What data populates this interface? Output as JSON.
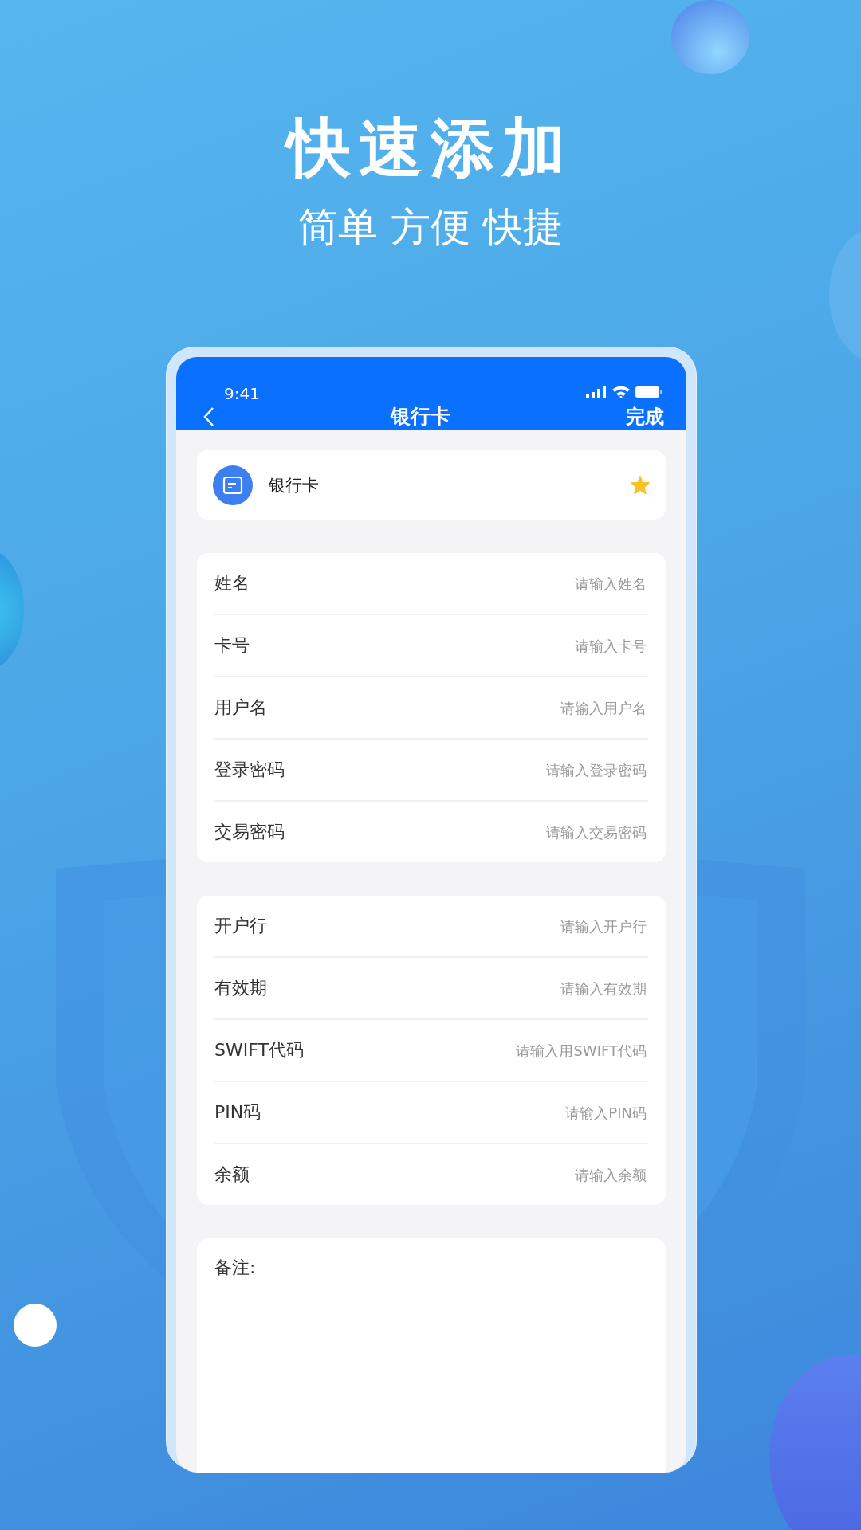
{
  "hero": {
    "title": "快速添加",
    "subtitle": "简单 方便 快捷"
  },
  "phone": {
    "status_bar": {
      "time": "9:41"
    },
    "nav": {
      "title": "银行卡",
      "action": "完成"
    },
    "category": {
      "label": "银行卡",
      "starred": true
    },
    "groups": [
      {
        "fields": [
          {
            "label": "姓名",
            "placeholder": "请输入姓名"
          },
          {
            "label": "卡号",
            "placeholder": "请输入卡号"
          },
          {
            "label": "用户名",
            "placeholder": "请输入用户名"
          },
          {
            "label": "登录密码",
            "placeholder": "请输入登录密码"
          },
          {
            "label": "交易密码",
            "placeholder": "请输入交易密码"
          }
        ]
      },
      {
        "fields": [
          {
            "label": "开户行",
            "placeholder": "请输入开户行"
          },
          {
            "label": "有效期",
            "placeholder": "请输入有效期"
          },
          {
            "label": "SWIFT代码",
            "placeholder": "请输入用SWIFT代码"
          },
          {
            "label": "PIN码",
            "placeholder": "请输入PIN码"
          },
          {
            "label": "余额",
            "placeholder": "请输入余额"
          }
        ]
      }
    ],
    "notes": {
      "label": "备注:"
    }
  }
}
